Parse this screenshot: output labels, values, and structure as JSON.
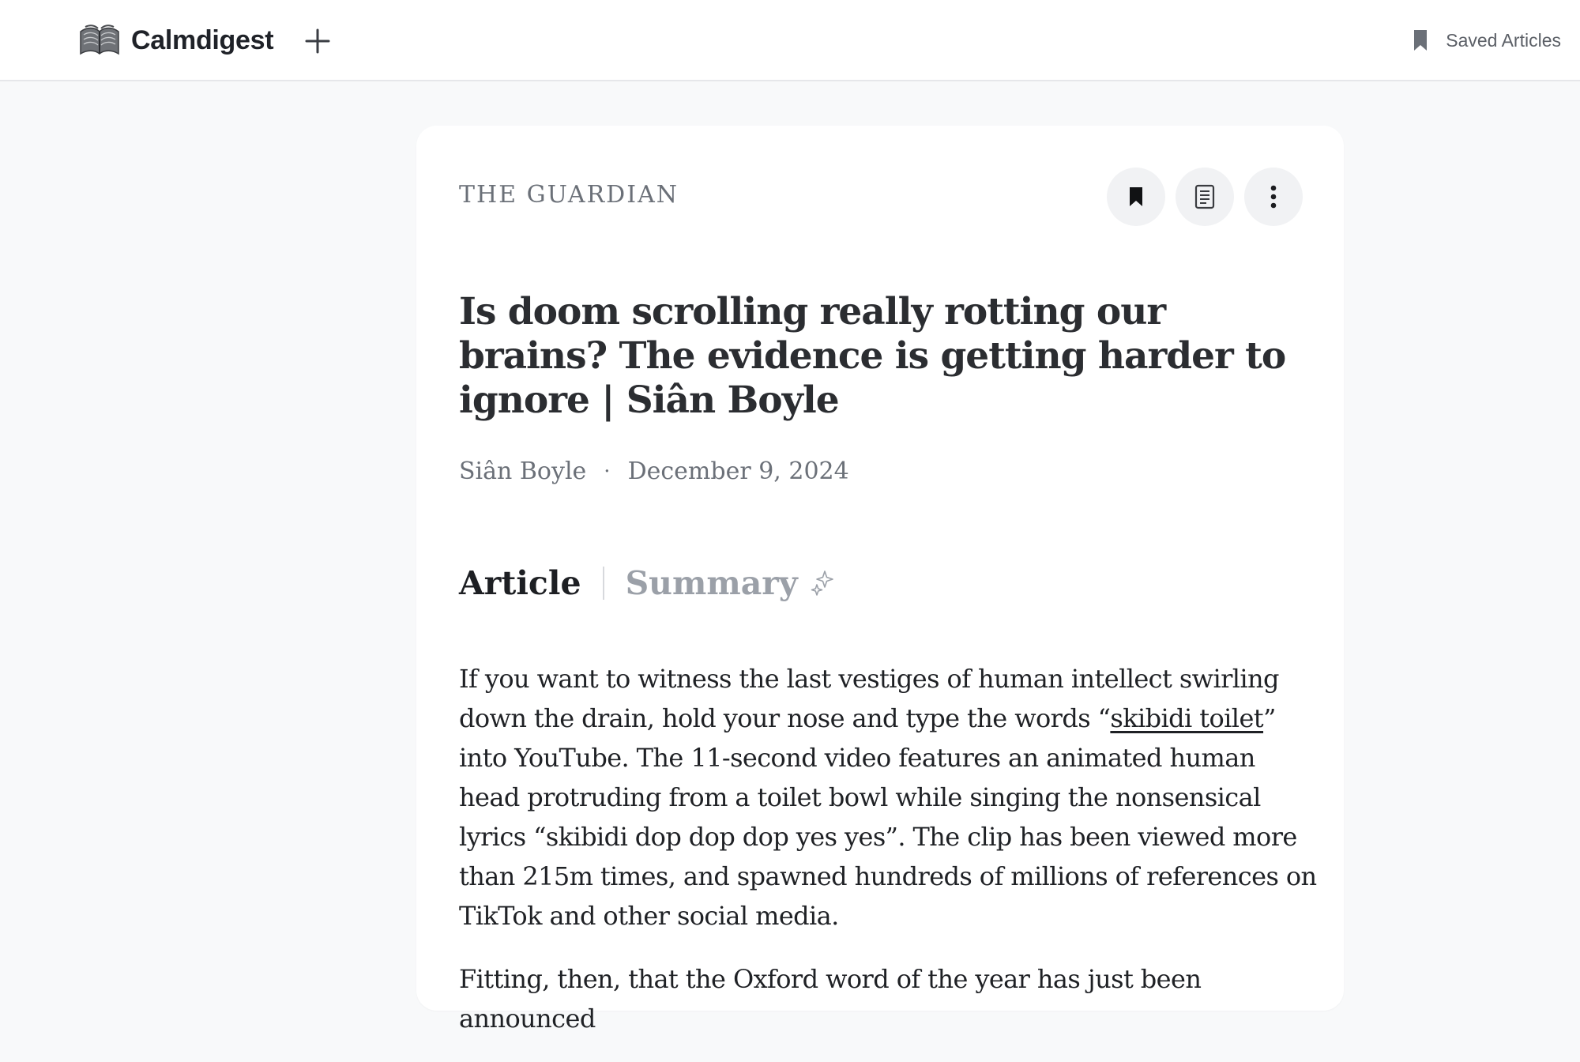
{
  "header": {
    "brand": "Calmdigest",
    "logo_icon": "book-icon",
    "add_icon": "plus-icon",
    "saved_label": "Saved Articles",
    "saved_icon": "bookmark-icon"
  },
  "article": {
    "source": "THE GUARDIAN",
    "title": "Is doom scrolling really rotting our brains? The evidence is getting harder to ignore | Siân Boyle",
    "author": "Siân Boyle",
    "separator": "·",
    "date": "December 9, 2024",
    "actions": [
      "bookmark-icon",
      "reader-view-icon",
      "more-options-icon"
    ],
    "tabs": {
      "article": "Article",
      "summary": "Summary",
      "summary_icon": "sparkle-icon"
    },
    "paragraphs": [
      {
        "before": "If you want to witness the last vestiges of human intellect swirling down the drain, hold your nose and type the words “",
        "link": "skibidi toilet",
        "after": "” into YouTube. The 11-second video features an animated human head protruding from a toilet bowl while singing the nonsensical lyrics “skibidi dop dop dop yes yes”. The clip has been viewed more than 215m times, and spawned hundreds of millions of references on TikTok and other social media."
      },
      {
        "before": "Fitting, then, that the Oxford word of the year has just been announced",
        "link": "",
        "after": ""
      }
    ]
  },
  "colors": {
    "page_bg": "#f8f9fa",
    "card_bg": "#ffffff",
    "text": "#1f2125",
    "muted": "#6b7078",
    "inactive_tab": "#9ba0a8",
    "button_bg": "#f1f2f4"
  }
}
